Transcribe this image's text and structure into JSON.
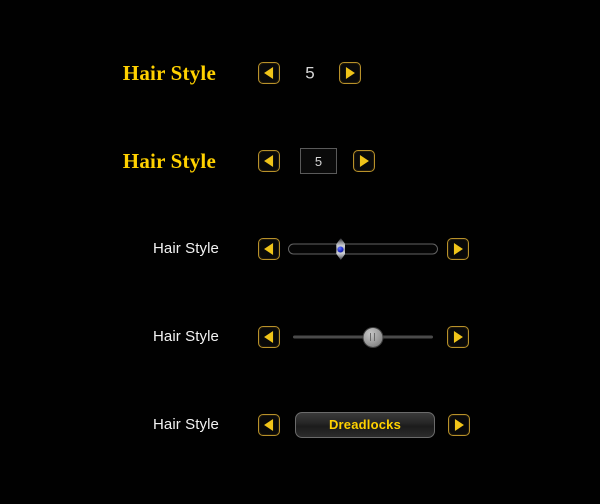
{
  "theme": {
    "background": "#010101",
    "gold": "#ffd100",
    "gold_arrow": "#f0c419",
    "gold_border": "#b8912a",
    "label_white": "#f2f2f2",
    "value_gray": "#d6d6d6",
    "track_gray": "#626262",
    "gem_blue": "#1b28c8"
  },
  "rows": [
    {
      "id": "stepper-plain",
      "label": "Hair Style",
      "prev_icon": "arrow-left-icon",
      "next_icon": "arrow-right-icon",
      "value": "5"
    },
    {
      "id": "stepper-boxed",
      "label": "Hair Style",
      "prev_icon": "arrow-left-icon",
      "next_icon": "arrow-right-icon",
      "value": "5",
      "placeholder": "5"
    },
    {
      "id": "slider-gem",
      "label": "Hair Style",
      "prev_icon": "arrow-left-icon",
      "next_icon": "arrow-right-icon",
      "percent": 35
    },
    {
      "id": "slider-knob",
      "label": "Hair Style",
      "prev_icon": "arrow-left-icon",
      "next_icon": "arrow-right-icon",
      "percent": 57
    },
    {
      "id": "selector-button",
      "label": "Hair Style",
      "prev_icon": "arrow-left-icon",
      "next_icon": "arrow-right-icon",
      "value": "Dreadlocks"
    }
  ]
}
